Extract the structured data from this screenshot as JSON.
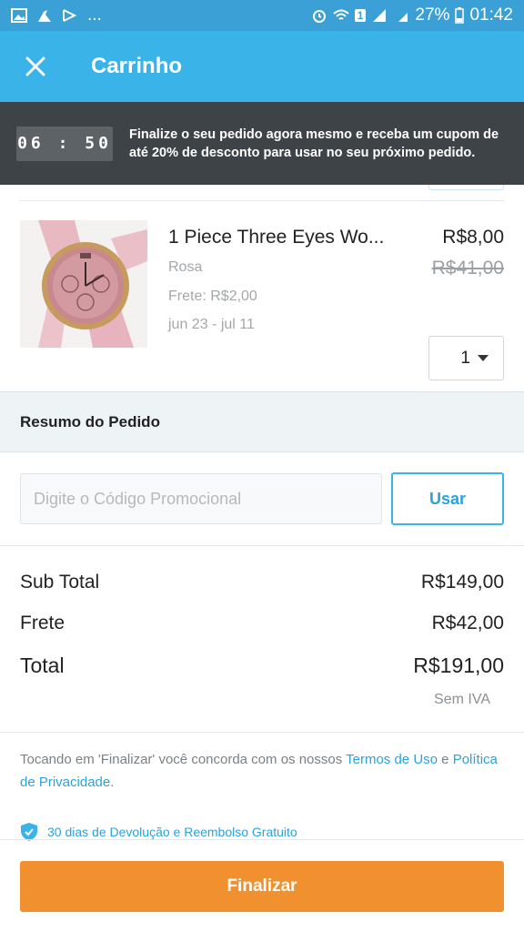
{
  "status_bar": {
    "left_text": "...",
    "signal_badge": "1",
    "battery": "27%",
    "time": "01:42"
  },
  "header": {
    "title": "Carrinho",
    "close_icon": "close-icon"
  },
  "promo_banner": {
    "timer": "06 : 50",
    "text": "Finalize o seu pedido agora mesmo e receba um cupom de até 20% de desconto para usar no seu próximo pedido."
  },
  "cart_item": {
    "title": "1 Piece Three Eyes Wo...",
    "variant": "Rosa",
    "shipping": "Frete: R$2,00",
    "delivery": "jun 23 - jul 11",
    "price": "R$8,00",
    "old_price": "R$41,00",
    "quantity": "1"
  },
  "summary": {
    "heading": "Resumo do Pedido",
    "promo_placeholder": "Digite o Código Promocional",
    "use_label": "Usar",
    "subtotal_label": "Sub Total",
    "subtotal_value": "R$149,00",
    "shipping_label": "Frete",
    "shipping_value": "R$42,00",
    "total_label": "Total",
    "total_value": "R$191,00",
    "vat_note": "Sem IVA"
  },
  "terms": {
    "prefix": "Tocando em 'Finalizar' você concorda com os nossos ",
    "terms_link": "Termos de Uso",
    "middle": " e ",
    "privacy_link": "Política de Privacidade",
    "suffix": "."
  },
  "guarantee": {
    "text": "30 dias de Devolução e Reembolso Gratuito"
  },
  "checkout": {
    "button_label": "Finalizar"
  },
  "colors": {
    "header_blue": "#3ab4e8",
    "banner_dark": "#3d4347",
    "accent_orange": "#f0902f",
    "link_blue": "#2aa3dd"
  }
}
